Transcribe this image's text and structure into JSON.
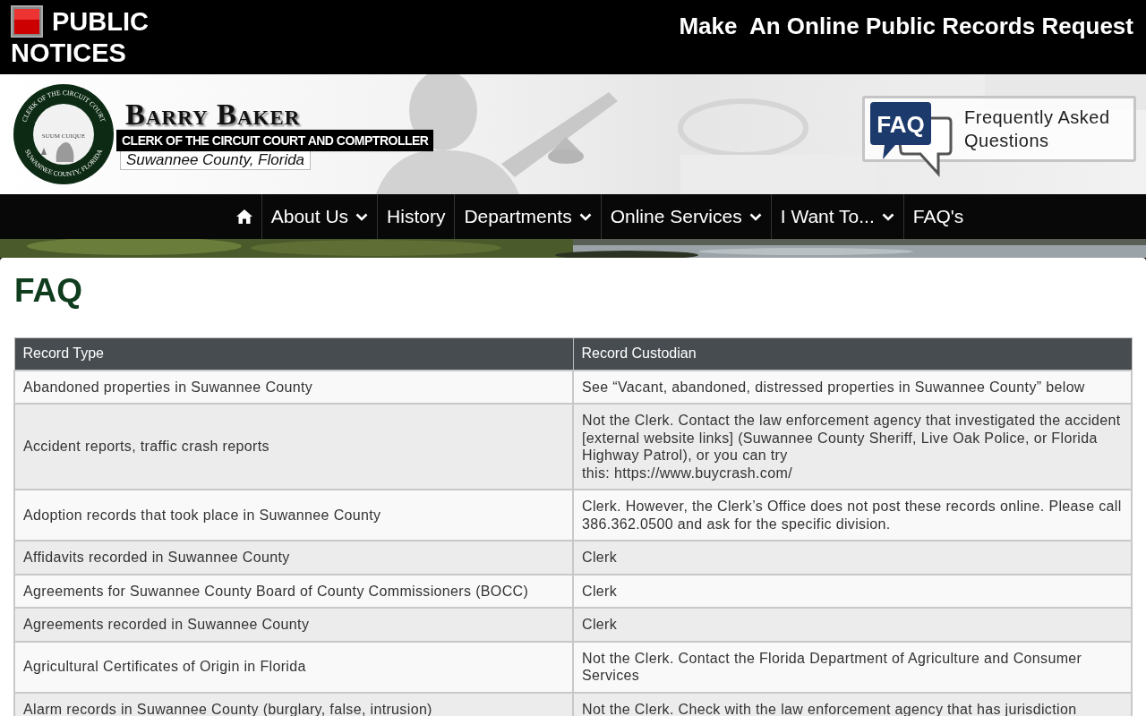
{
  "top_bar": {
    "public_notices": [
      "PUBLIC",
      "NOTICES"
    ],
    "records_request": "Make  An Online Public Records Request"
  },
  "header": {
    "seal": {
      "top": "CLERK OF THE CIRCUIT COURT",
      "motto": "SUUM CUIQUE",
      "bottom": "SUWANNEE COUNTY, FLORIDA"
    },
    "name": "Barry Baker",
    "title": "CLERK OF THE CIRCUIT COURT AND COMPTROLLER",
    "county": "Suwannee County, Florida",
    "faq_badge": {
      "icon_text": "FAQ",
      "label": "Frequently Asked Questions"
    }
  },
  "nav": {
    "items": [
      {
        "kind": "home"
      },
      {
        "kind": "menu",
        "label": "About Us",
        "dropdown": true
      },
      {
        "kind": "menu",
        "label": "History",
        "dropdown": false
      },
      {
        "kind": "menu",
        "label": "Departments",
        "dropdown": true
      },
      {
        "kind": "menu",
        "label": "Online Services",
        "dropdown": true
      },
      {
        "kind": "menu",
        "label": "I Want To...",
        "dropdown": true
      },
      {
        "kind": "menu",
        "label": "FAQ's",
        "dropdown": false
      }
    ]
  },
  "page_title": "FAQ",
  "table": {
    "columns": [
      "Record Type",
      "Record Custodian"
    ],
    "rows": [
      [
        "Abandoned properties in Suwannee County",
        "See “Vacant, abandoned, distressed properties in Suwannee County” below"
      ],
      [
        "Accident reports, traffic crash reports",
        "Not the Clerk.  Contact the law enforcement agency that investigated the accident [external website links] (Suwannee County Sheriff, Live Oak Police, or Florida Highway Patrol), or you can try\nthis: https://www.buycrash.com/"
      ],
      [
        "Adoption records that took place in Suwannee County",
        "Clerk.  However, the Clerk’s Office does not post these records online.  Please call 386.362.0500 and ask for the specific division."
      ],
      [
        "Affidavits recorded in Suwannee County",
        "Clerk"
      ],
      [
        "Agreements for Suwannee County Board of County Commissioners (BOCC)",
        "Clerk"
      ],
      [
        "Agreements recorded in Suwannee County",
        "Clerk"
      ],
      [
        "Agricultural Certificates of Origin in Florida",
        "Not the Clerk.  Contact the Florida Department of Agriculture and Consumer Services"
      ],
      [
        "Alarm records in Suwannee County (burglary, false, intrusion)",
        "Not the Clerk.  Check with the law enforcement agency that has jurisdiction"
      ]
    ]
  }
}
